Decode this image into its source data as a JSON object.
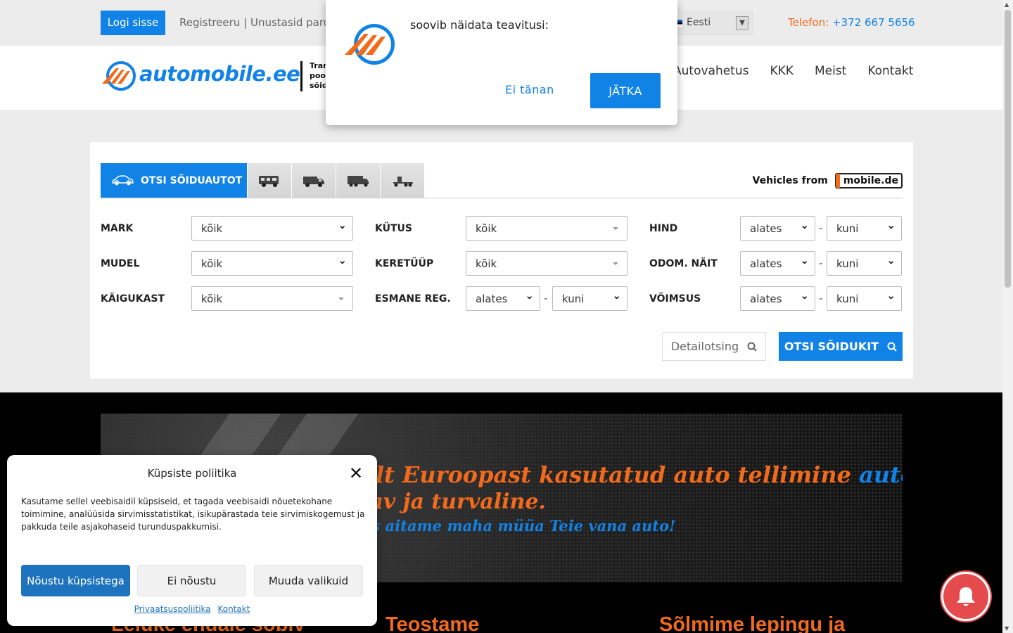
{
  "topbar": {
    "login_label": "Logi sisse",
    "register_label": "Registreeru",
    "separator": "|",
    "forgot_label": "Unustasid parool",
    "language": "Eesti",
    "phone_label": "Telefon:",
    "phone_number": "+372 667 5656"
  },
  "header": {
    "logo_text": "automobile.ee",
    "tagline": "Tran pool sõid",
    "nav": [
      "Autovahetus",
      "KKK",
      "Meist",
      "Kontakt"
    ]
  },
  "search": {
    "active_tab_label": "OTSI SÕIDUAUTOT",
    "tab_icons": [
      "camper-icon",
      "van-icon",
      "truck-icon",
      "semi-truck-icon"
    ],
    "vehicles_from_label": "Vehicles from",
    "mobile_de_label": "mobile.de",
    "fields": {
      "mark": {
        "label": "MARK",
        "value": "kõik"
      },
      "mudel": {
        "label": "MUDEL",
        "value": "kõik"
      },
      "kaigukast": {
        "label": "KÄIGUKAST",
        "value": "kõik"
      },
      "kutus": {
        "label": "KÜTUS",
        "value": "kõik"
      },
      "keretuup": {
        "label": "KERETÜÜP",
        "value": "kõik"
      },
      "esmane_reg": {
        "label": "ESMANE REG.",
        "from": "alates",
        "to": "kuni"
      },
      "hind": {
        "label": "HIND",
        "from": "alates",
        "to": "kuni"
      },
      "odom": {
        "label": "ODOM. NÄIT",
        "from": "alates",
        "to": "kuni"
      },
      "voimsus": {
        "label": "VÕIMSUS",
        "from": "alates",
        "to": "kuni"
      }
    },
    "range_dash": "-",
    "detail_label": "Detailotsing",
    "submit_label": "OTSI SÕIDUKIT"
  },
  "banner": {
    "line1_orange": "Saksamaalt või mujalt Euroopast kasutatud auto tellimine",
    "line1_blue": "automobile.ee",
    "line2": "kaudu on lihtne, mugav ja turvaline.",
    "line3": "Lisaks aitame maha müüa Teie vana auto!"
  },
  "steps": [
    "Leiuke endale sobiv",
    "Teostame",
    "Sõlmime lepingu ja"
  ],
  "notification": {
    "message": "soovib näidata teavitusi:",
    "decline_label": "Ei tänan",
    "accept_label": "JÄTKA"
  },
  "cookie": {
    "title": "Küpsiste poliitika",
    "text": "Kasutame sellel veebisaidil küpsiseid, et tagada veebisaidi nõuetekohane toimimine, analüüsida sirvimisstatistikat, isikupärastada teie sirvimiskogemust ja pakkuda teile asjakohaseid turunduspakkumisi.",
    "accept_label": "Nõustu küpsistega",
    "deny_label": "Ei nõustu",
    "prefs_label": "Muuda valikuid",
    "privacy_link": "Privaatsuspoliitika",
    "contact_link": "Kontakt"
  },
  "colors": {
    "brand_blue": "#1182e6",
    "brand_orange": "#f26a1b",
    "bell_red": "#e54b4d"
  }
}
